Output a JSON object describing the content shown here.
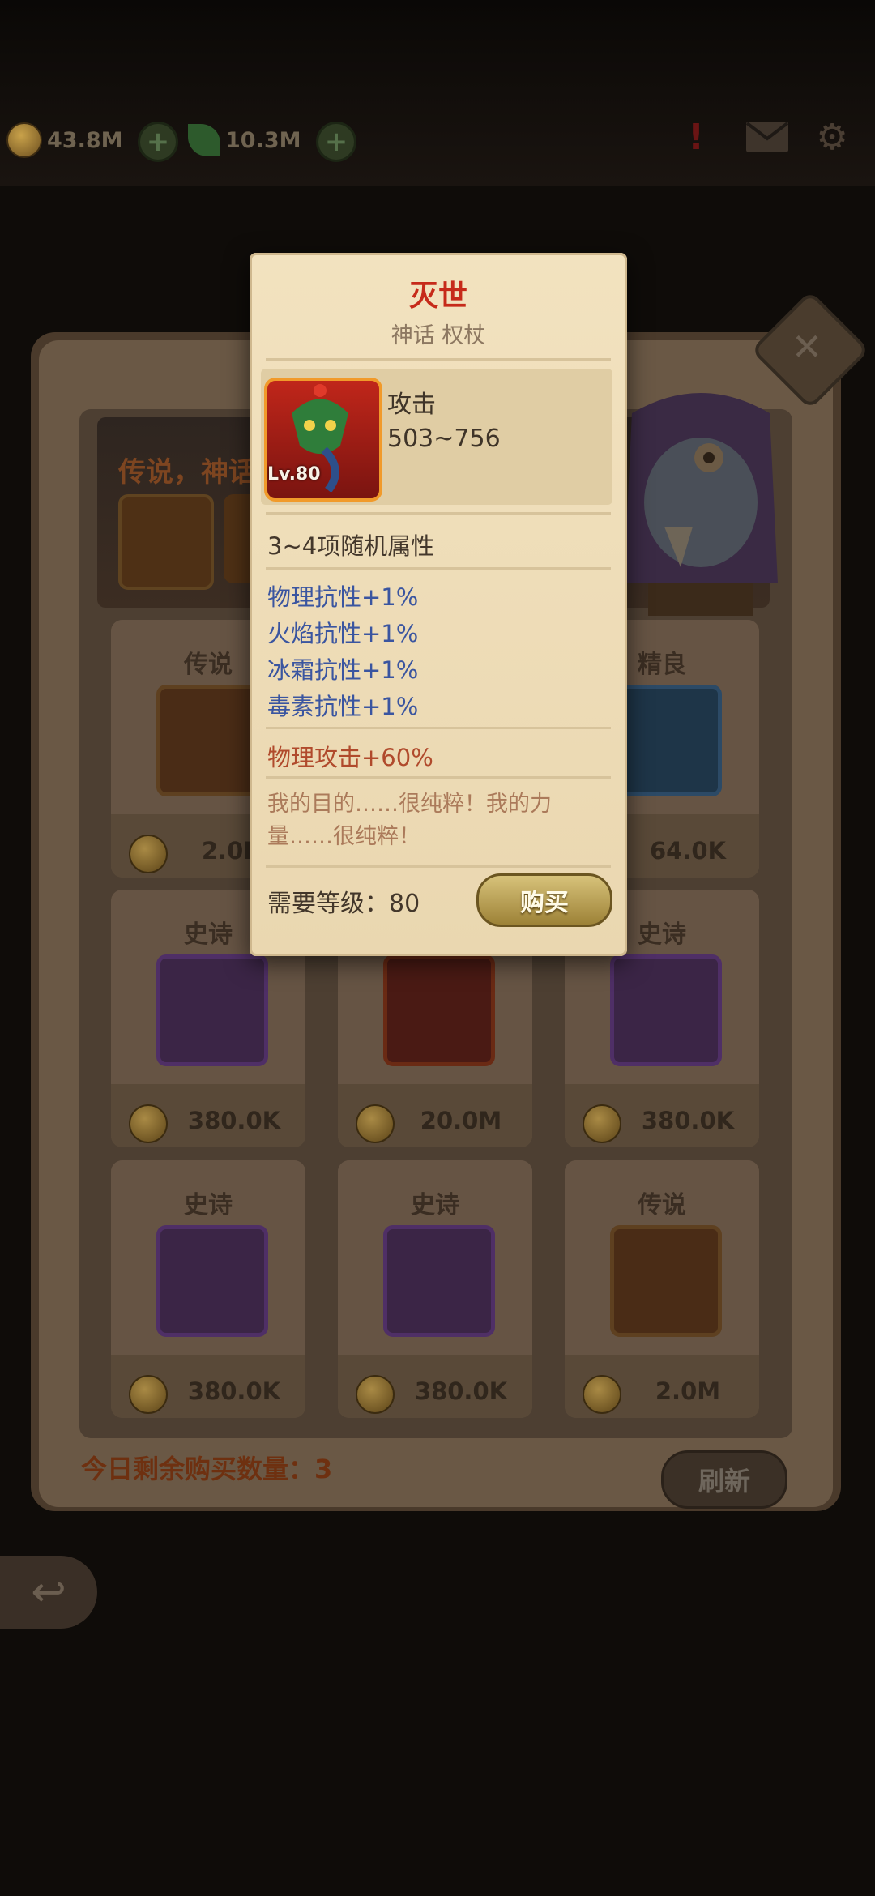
{
  "topbar": {
    "gold": "43.8M",
    "gems": "10.3M",
    "alert_badge": "!"
  },
  "banner": {
    "text": "传说，神话"
  },
  "shop_items": [
    {
      "rarity": "传说",
      "price": "2.0M",
      "icon": "sword-icon",
      "frame": "orange"
    },
    {
      "rarity": "",
      "price": "",
      "icon": "",
      "frame": ""
    },
    {
      "rarity": "精良",
      "price": "64.0K",
      "icon": "boot-icon",
      "frame": "blue"
    },
    {
      "rarity": "史诗",
      "price": "380.0K",
      "icon": "gauntlet-icon",
      "frame": "purple"
    },
    {
      "rarity": "",
      "price": "20.0M",
      "icon": "dragon-staff-icon",
      "frame": "red"
    },
    {
      "rarity": "史诗",
      "price": "380.0K",
      "icon": "longsword-icon",
      "frame": "purple"
    },
    {
      "rarity": "史诗",
      "price": "380.0K",
      "icon": "armor-boot-icon",
      "frame": "purple"
    },
    {
      "rarity": "史诗",
      "price": "380.0K",
      "icon": "dagger-icon",
      "frame": "purple"
    },
    {
      "rarity": "传说",
      "price": "2.0M",
      "icon": "ring-icon",
      "frame": "orange"
    }
  ],
  "footer": {
    "remaining_label": "今日剩余购买数量：3",
    "refresh_label": "刷新"
  },
  "tooltip": {
    "title": "灭世",
    "subtitle": "神话 权杖",
    "level_badge": "Lv.80",
    "attack_label": "攻击",
    "attack_value": "503~756",
    "random_attrs_label": "3~4项随机属性",
    "attrs": [
      "物理抗性+1%",
      "火焰抗性+1%",
      "冰霜抗性+1%",
      "毒素抗性+1%"
    ],
    "main_attr": "物理攻击+60%",
    "quote": "我的目的……很纯粹！我的力量……很纯粹！",
    "required_level": "需要等级：80",
    "buy_label": "购买"
  },
  "colors": {
    "title_red": "#c62a1a",
    "attr_blue": "#3a55a0",
    "main_attr": "#b04a2c",
    "parchment": "#f2e2bf"
  }
}
